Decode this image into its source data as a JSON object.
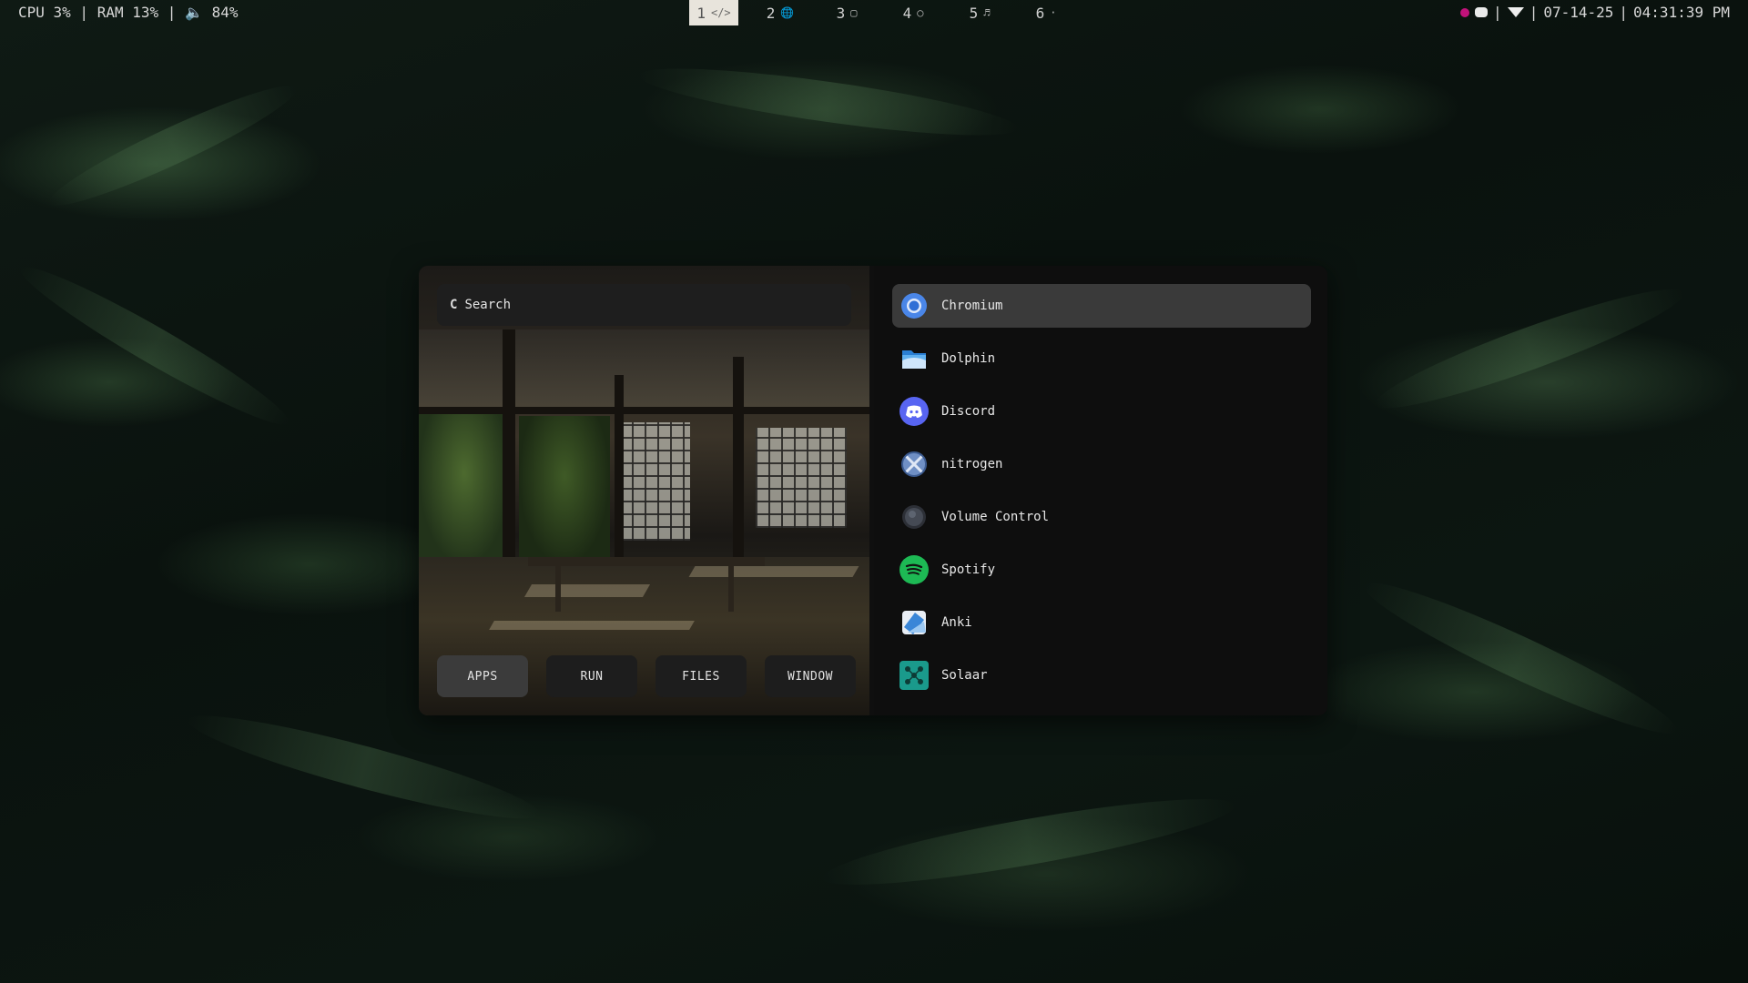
{
  "topbar": {
    "stats": "CPU 3% | RAM 13% | 🔈 84%",
    "workspaces": [
      {
        "num": "1",
        "glyph": "</>",
        "icon": "code-icon",
        "active": true
      },
      {
        "num": "2",
        "glyph": "🌐",
        "icon": "globe-icon",
        "active": false
      },
      {
        "num": "3",
        "glyph": "▢",
        "icon": "document-icon",
        "active": false
      },
      {
        "num": "4",
        "glyph": "○",
        "icon": "chat-icon",
        "active": false
      },
      {
        "num": "5",
        "glyph": "♬",
        "icon": "music-icon",
        "active": false
      },
      {
        "num": "6",
        "glyph": "·",
        "icon": "dot-icon",
        "active": false
      }
    ],
    "separator": "|",
    "date": "07-14-25",
    "time": "04:31:39 PM"
  },
  "launcher": {
    "search": {
      "placeholder": "Search",
      "value": ""
    },
    "modes": [
      {
        "label": "APPS",
        "active": true
      },
      {
        "label": "RUN",
        "active": false
      },
      {
        "label": "FILES",
        "active": false
      },
      {
        "label": "WINDOW",
        "active": false
      }
    ],
    "apps": [
      {
        "label": "Chromium",
        "icon": "chromium-icon",
        "selected": true
      },
      {
        "label": "Dolphin",
        "icon": "folder-icon",
        "selected": false
      },
      {
        "label": "Discord",
        "icon": "discord-icon",
        "selected": false
      },
      {
        "label": "nitrogen",
        "icon": "nitrogen-icon",
        "selected": false
      },
      {
        "label": "Volume Control",
        "icon": "volume-icon",
        "selected": false
      },
      {
        "label": "Spotify",
        "icon": "spotify-icon",
        "selected": false
      },
      {
        "label": "Anki",
        "icon": "anki-icon",
        "selected": false
      },
      {
        "label": "Solaar",
        "icon": "solaar-icon",
        "selected": false
      }
    ]
  },
  "colors": {
    "accent_selected": "#3a3a3a",
    "workspace_active": "#e8e4dc",
    "discord": "#5865f2",
    "spotify": "#1db954",
    "solaar": "#1a9a8c"
  }
}
